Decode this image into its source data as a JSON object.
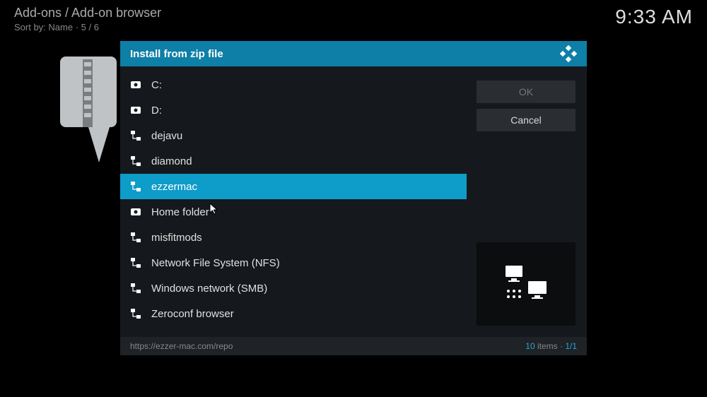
{
  "header": {
    "breadcrumb": "Add-ons / Add-on browser",
    "sortby": "Sort by: Name  ·  5 / 6",
    "clock": "9:33 AM"
  },
  "dialog": {
    "title": "Install from zip file",
    "items": [
      {
        "label": "C:",
        "icon": "drive"
      },
      {
        "label": "D:",
        "icon": "drive"
      },
      {
        "label": "dejavu",
        "icon": "network"
      },
      {
        "label": "diamond",
        "icon": "network"
      },
      {
        "label": "ezzermac",
        "icon": "network",
        "selected": true
      },
      {
        "label": "Home folder",
        "icon": "drive"
      },
      {
        "label": "misfitmods",
        "icon": "network"
      },
      {
        "label": "Network File System (NFS)",
        "icon": "network"
      },
      {
        "label": "Windows network (SMB)",
        "icon": "network"
      },
      {
        "label": "Zeroconf browser",
        "icon": "network"
      }
    ],
    "buttons": {
      "ok": "OK",
      "cancel": "Cancel"
    },
    "footer": {
      "path": "https://ezzer-mac.com/repo",
      "count_num": "10",
      "count_label": " items · ",
      "page": "1/1"
    }
  }
}
